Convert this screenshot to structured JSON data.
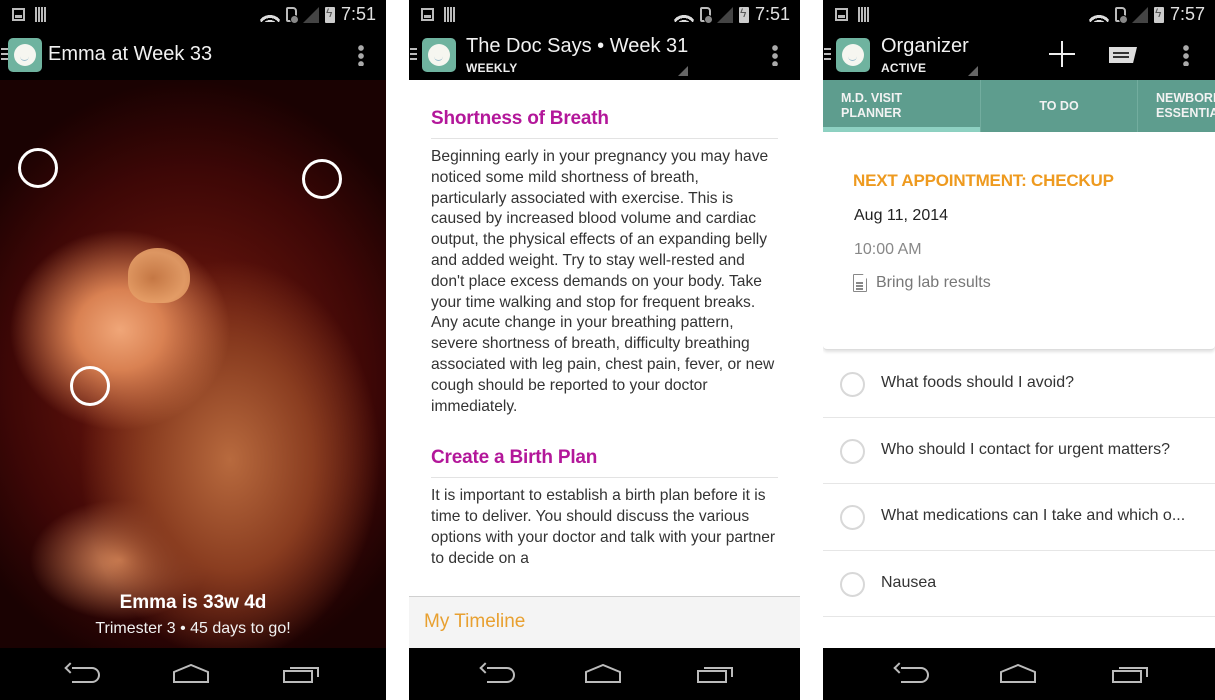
{
  "screens": [
    {
      "status_bar": {
        "time": "7:51"
      },
      "action_bar": {
        "title": "Emma at Week 33"
      },
      "caption": {
        "headline": "Emma is 33w 4d",
        "subline": "Trimester 3 • 45 days to go!"
      },
      "hotspots": [
        "hotspot",
        "hotspot",
        "hotspot"
      ]
    },
    {
      "status_bar": {
        "time": "7:51"
      },
      "action_bar": {
        "title": "The Doc Says • Week 31",
        "subtitle": "WEEKLY"
      },
      "sections": [
        {
          "heading": "Shortness of Breath",
          "body": "Beginning early in your pregnancy you may have noticed some mild shortness of breath, particularly associated with exercise. This is caused by increased blood volume and cardiac output, the physical effects of an expanding belly and added weight. Try to stay well-rested and don't place excess demands on your body. Take your time walking and stop for frequent breaks. Any acute change in your breathing pattern, severe shortness of breath, difficulty breathing associated with leg pain, chest pain, fever, or new cough should be reported to your doctor immediately."
        },
        {
          "heading": "Create a Birth Plan",
          "body": "It is important to establish a birth plan before it is time to deliver. You should discuss the various options with your doctor and talk with your partner to decide on a"
        }
      ],
      "footer": {
        "label": "My Timeline"
      }
    },
    {
      "status_bar": {
        "time": "7:57"
      },
      "action_bar": {
        "title": "Organizer",
        "subtitle": "ACTIVE"
      },
      "tabs": [
        {
          "label": "M.D. VISIT\nPLANNER",
          "active": true
        },
        {
          "label": "TO DO",
          "active": false
        },
        {
          "label": "NEWBORN\nESSENTIALS",
          "active": false
        }
      ],
      "appointment": {
        "title": "NEXT APPOINTMENT: CHECKUP",
        "date": "Aug 11, 2014",
        "time": "10:00 AM",
        "note": "Bring lab results"
      },
      "todos": [
        {
          "text": "What foods should I avoid?",
          "checked": false
        },
        {
          "text": "Who should I contact for urgent matters?",
          "checked": false
        },
        {
          "text": "What medications can I take and which o...",
          "checked": false
        },
        {
          "text": "Nausea",
          "checked": false
        }
      ]
    }
  ],
  "colors": {
    "brand_teal": "#6fb39f",
    "tab_bar": "#5e9d8e",
    "tab_indicator": "#8ed1c2",
    "heading_magenta": "#b3179a",
    "accent_orange": "#ee9a1f"
  }
}
